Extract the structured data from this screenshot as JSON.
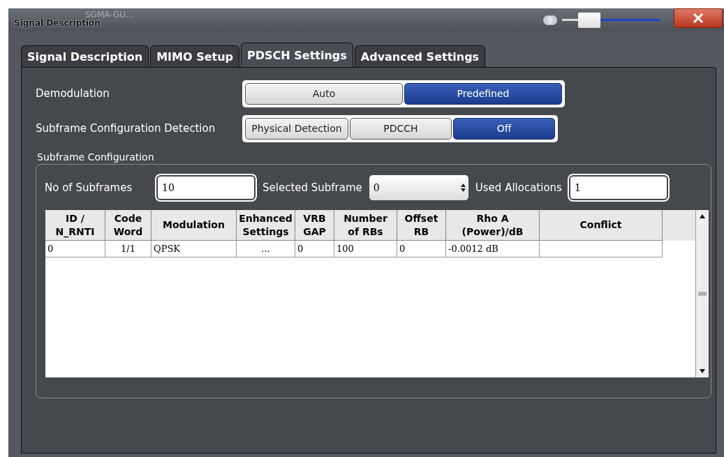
{
  "window": {
    "title": "Signal Description",
    "background_title": "SGMA-GU…",
    "transparency": {
      "level": 0.28
    }
  },
  "tabs": [
    {
      "label": "Signal Description",
      "selected": false
    },
    {
      "label": "MIMO Setup",
      "selected": false
    },
    {
      "label": "PDSCH Settings",
      "selected": true
    },
    {
      "label": "Advanced Settings",
      "selected": false
    }
  ],
  "demodulation": {
    "label": "Demodulation",
    "options": [
      {
        "label": "Auto",
        "selected": false
      },
      {
        "label": "Predefined",
        "selected": true
      }
    ]
  },
  "detection": {
    "label": "Subframe Configuration Detection",
    "options": [
      {
        "label": "Physical Detection",
        "selected": false
      },
      {
        "label": "PDCCH",
        "selected": false
      },
      {
        "label": "Off",
        "selected": true
      }
    ]
  },
  "subframe_configuration": {
    "title": "Subframe Configuration",
    "no_of_subframes": {
      "label": "No of Subframes",
      "value": "10"
    },
    "selected_subframe": {
      "label": "Selected Subframe",
      "value": "0"
    },
    "used_allocations": {
      "label": "Used Allocations",
      "value": "1"
    },
    "table": {
      "columns": [
        "ID /\nN_RNTI",
        "Code\nWord",
        "Modulation",
        "Enhanced\nSettings",
        "VRB\nGAP",
        "Number\nof RBs",
        "Offset\nRB",
        "Rho A\n(Power)/dB",
        "Conflict"
      ],
      "rows": [
        [
          "0",
          "1/1",
          "QPSK",
          "...",
          "0",
          "100",
          "0",
          "-0.0012 dB",
          ""
        ]
      ]
    }
  }
}
